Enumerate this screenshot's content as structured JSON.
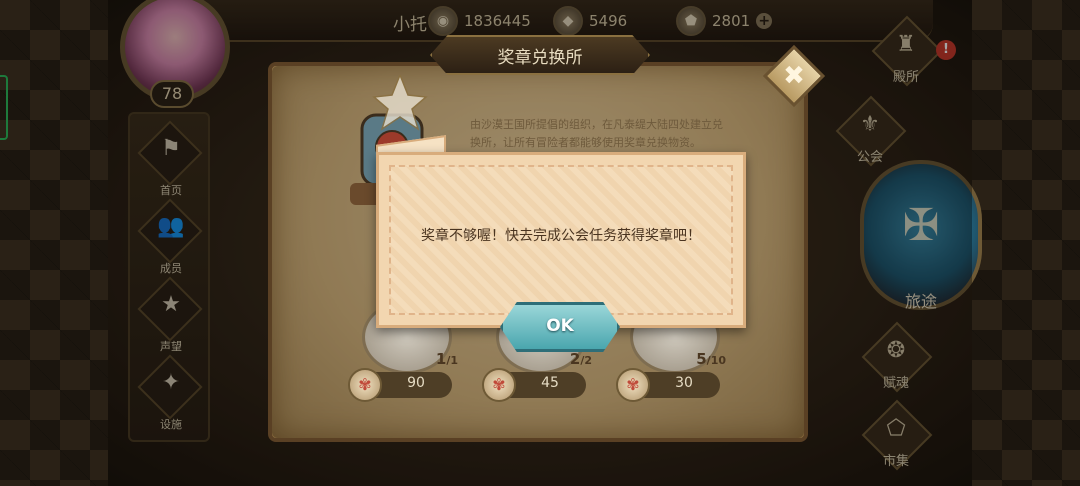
{
  "header": {
    "player_name": "小托",
    "level": "78",
    "resources": [
      {
        "icon": "gold-coin-icon",
        "value": "1836445"
      },
      {
        "icon": "crystal-icon",
        "value": "5496"
      },
      {
        "icon": "stone-icon",
        "value": "2801"
      }
    ],
    "plus_label": "+"
  },
  "left_nav": [
    {
      "label": "首页",
      "icon": "home-icon"
    },
    {
      "label": "成员",
      "icon": "members-icon"
    },
    {
      "label": "声望",
      "icon": "reputation-icon"
    },
    {
      "label": "设施",
      "icon": "facility-icon"
    }
  ],
  "right_nav": {
    "top": {
      "label": "殿所",
      "icon": "hall-icon",
      "alert": "!"
    },
    "guild": {
      "label": "公会",
      "icon": "guild-icon"
    },
    "travel": {
      "label": "旅途",
      "icon": "travel-emblem-icon"
    },
    "trade": {
      "label": "赋魂",
      "icon": "soul-icon"
    },
    "market": {
      "label": "市集",
      "icon": "market-icon"
    }
  },
  "panel": {
    "title": "奖章兑换所",
    "description": "由沙漠王国所提倡的组织，在凡泰缇大陆四处建立兑换所，让所有冒险者都能够使用奖章兑换物资。",
    "items": [
      {
        "owned": "1",
        "total": "/1",
        "price": "90"
      },
      {
        "owned": "2",
        "total": "/2",
        "price": "45"
      },
      {
        "owned": "5",
        "total": "/10",
        "price": "30"
      }
    ],
    "close_label": "✖"
  },
  "dialog": {
    "message": "奖章不够喔！快去完成公会任务获得奖章吧！",
    "ok_label": "OK"
  },
  "colors": {
    "panel_parchment": "#c8ac7a",
    "dialog_bg": "#f2d6b0",
    "ok_button": "#4aa6ae",
    "alert_red": "#c8392c"
  }
}
